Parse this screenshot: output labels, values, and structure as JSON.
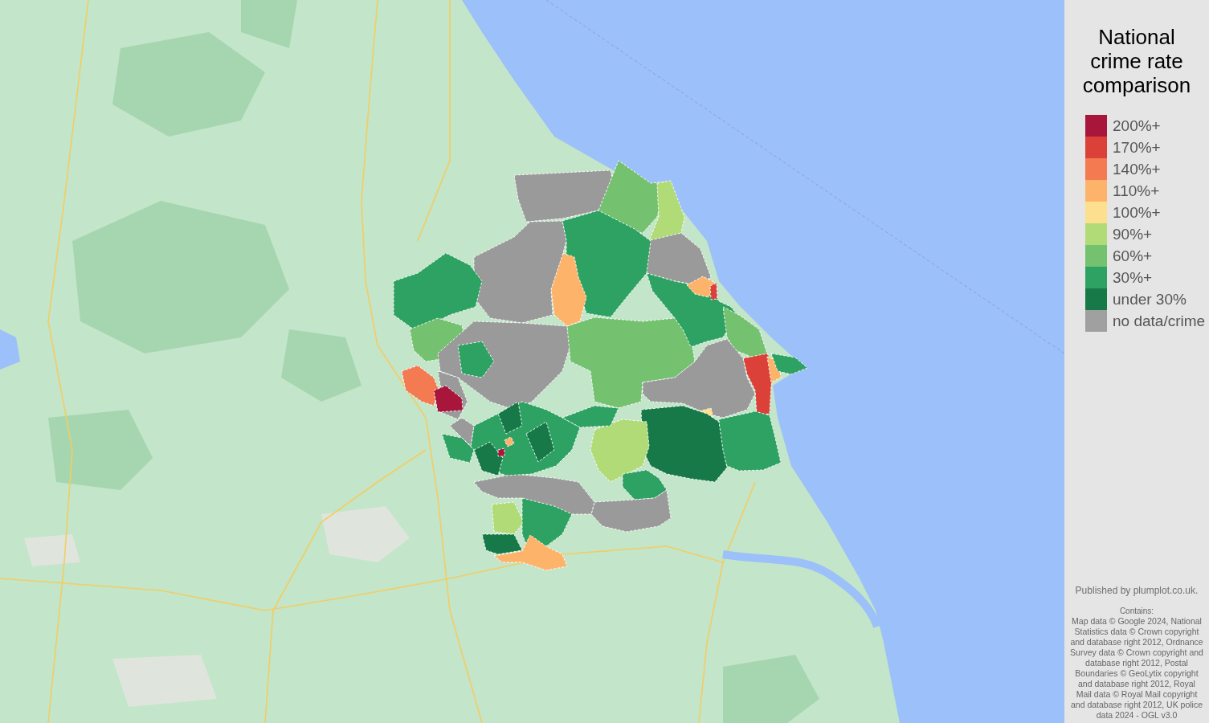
{
  "legend": {
    "title": "National crime rate comparison",
    "items": [
      {
        "label": "200%+",
        "color": "#a8173b"
      },
      {
        "label": "170%+",
        "color": "#dc4139"
      },
      {
        "label": "140%+",
        "color": "#f47a52"
      },
      {
        "label": "110%+",
        "color": "#fdb46a"
      },
      {
        "label": "100%+",
        "color": "#fde08f"
      },
      {
        "label": "90%+",
        "color": "#b0db77"
      },
      {
        "label": "60%+",
        "color": "#74c26f"
      },
      {
        "label": "30%+",
        "color": "#2ea262"
      },
      {
        "label": "under 30%",
        "color": "#177848"
      },
      {
        "label": "no data/crime",
        "color": "#a0a0a0"
      }
    ]
  },
  "credits": {
    "published": "Published by plumplot.co.uk.",
    "contains_label": "Contains:",
    "attribution": "Map data © Google 2024, National Statistics data © Crown copyright and database right 2012, Ordnance Survey data © Crown copyright and database right 2012, Postal Boundaries © GeoLytix copyright and database right 2012, Royal Mail data © Royal Mail copyright and database right 2012, UK police data 2024 - OGL v3.0"
  }
}
